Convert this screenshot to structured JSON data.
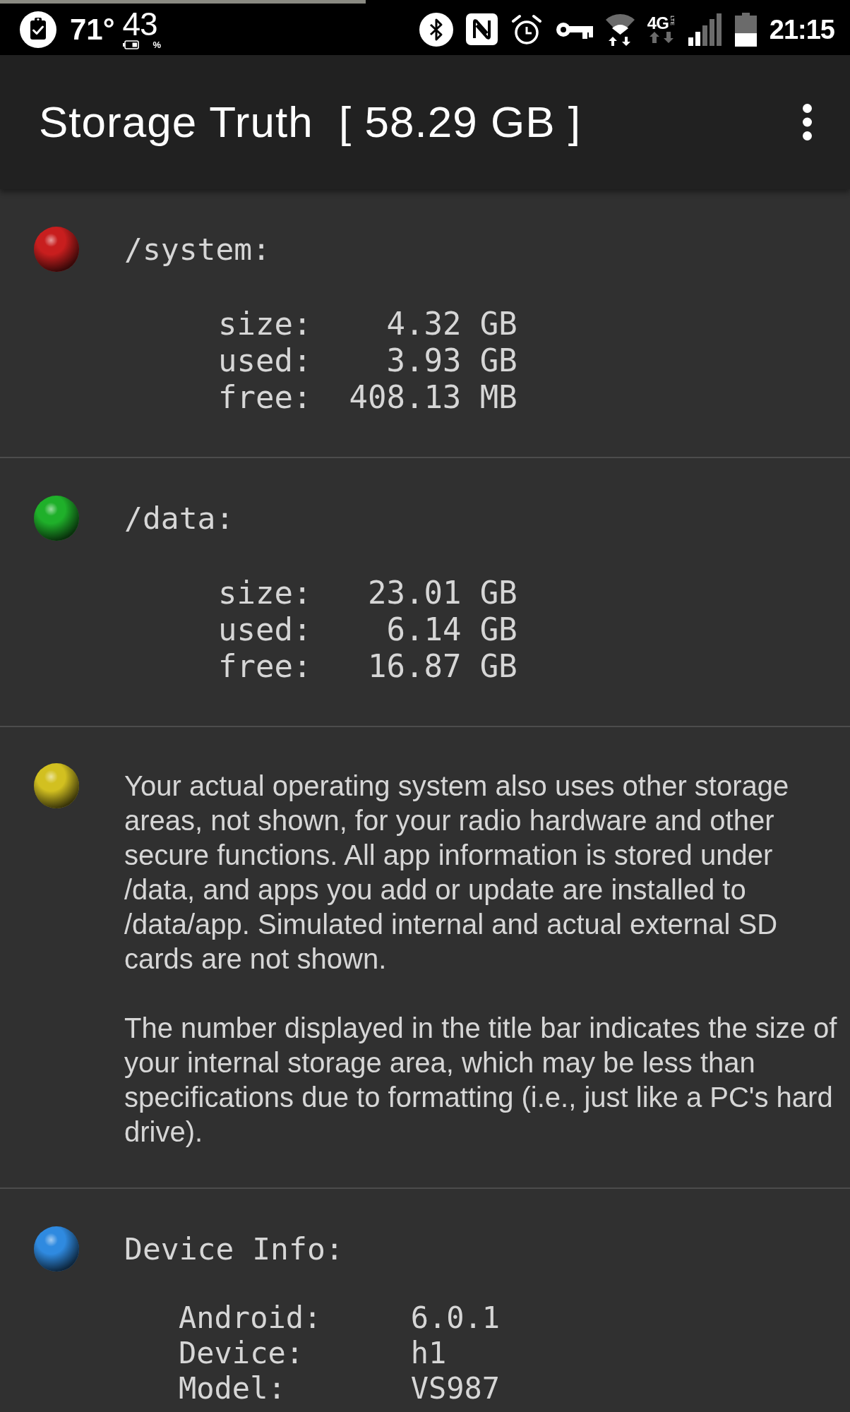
{
  "status_bar": {
    "temperature": "71°",
    "battery": {
      "level": 0.43,
      "percent": "43",
      "unit": "%"
    },
    "network": {
      "type": "4G",
      "badge": "LTE"
    },
    "time": "21:15"
  },
  "app_bar": {
    "title": "Storage Truth  [ 58.29 GB ]"
  },
  "sections": [
    {
      "kind": "partition",
      "color": "#c81e1e",
      "title": "/system:",
      "rows": [
        {
          "label": "size:",
          "value": "4.32 GB"
        },
        {
          "label": "used:",
          "value": "3.93 GB"
        },
        {
          "label": "free:",
          "value": "408.13 MB"
        }
      ]
    },
    {
      "kind": "partition",
      "color": "#1fb02a",
      "title": "/data:",
      "rows": [
        {
          "label": "size:",
          "value": "23.01 GB"
        },
        {
          "label": "used:",
          "value": "6.14 GB"
        },
        {
          "label": "free:",
          "value": "16.87 GB"
        }
      ]
    },
    {
      "kind": "note",
      "color": "#d2c020",
      "paragraphs": [
        "Your actual operating system also uses other storage areas, not shown, for your radio hardware and other secure functions. All app information is stored under /data, and apps you add or update are installed to /data/app. Simulated internal and actual external SD cards are not shown.",
        "The number displayed in the title bar indicates the size of your internal storage area, which may be less than specifications due to formatting (i.e., just like a PC's hard drive)."
      ]
    },
    {
      "kind": "info",
      "color": "#2f8ae0",
      "title": "Device Info:",
      "rows": [
        {
          "label": "Android:",
          "value": "6.0.1"
        },
        {
          "label": "Device:",
          "value": "h1"
        },
        {
          "label": "Model:",
          "value": "VS987"
        }
      ]
    }
  ]
}
